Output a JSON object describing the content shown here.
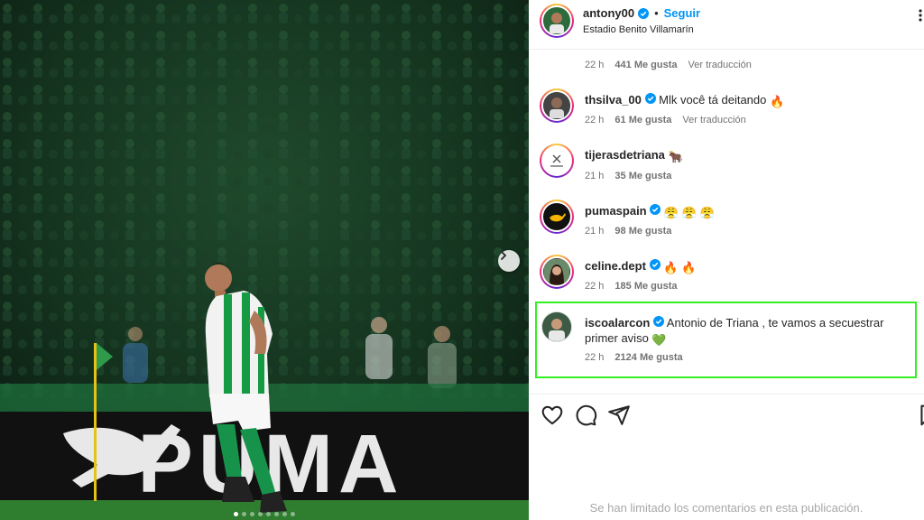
{
  "post": {
    "username": "antony00",
    "separator": "•",
    "follow_label": "Seguir",
    "location": "Estadio Benito Villamarín"
  },
  "first_meta": {
    "time": "22 h",
    "likes": "441 Me gusta",
    "translate": "Ver traducción"
  },
  "comments": [
    {
      "username": "thsilva_00",
      "text": "Mlk você tá deitando",
      "emoji": "🔥",
      "time": "22 h",
      "likes": "61 Me gusta",
      "translate": "Ver traducción"
    },
    {
      "username": "tijerasdetriana",
      "text": "",
      "emoji": "🐂",
      "time": "21 h",
      "likes": "35 Me gusta"
    },
    {
      "username": "pumaspain",
      "text": "",
      "emoji": "😤 😤 😤",
      "time": "21 h",
      "likes": "98 Me gusta"
    },
    {
      "username": "celine.dept",
      "text": "",
      "emoji": "🔥 🔥",
      "time": "22 h",
      "likes": "185 Me gusta"
    },
    {
      "username": "iscoalarcon",
      "text": "Antonio de Triana , te vamos a secuestrar primer aviso",
      "emoji": "💚",
      "time": "22 h",
      "likes": "2124 Me gusta"
    }
  ],
  "footer": {
    "limited_text": "Se han limitado los comentarios en esta publicación."
  },
  "photo": {
    "board_text": "PUMA",
    "slide_count": 8,
    "active_slide": 1
  },
  "colors": {
    "accent": "#0095f6",
    "highlight": "#33ee22"
  }
}
